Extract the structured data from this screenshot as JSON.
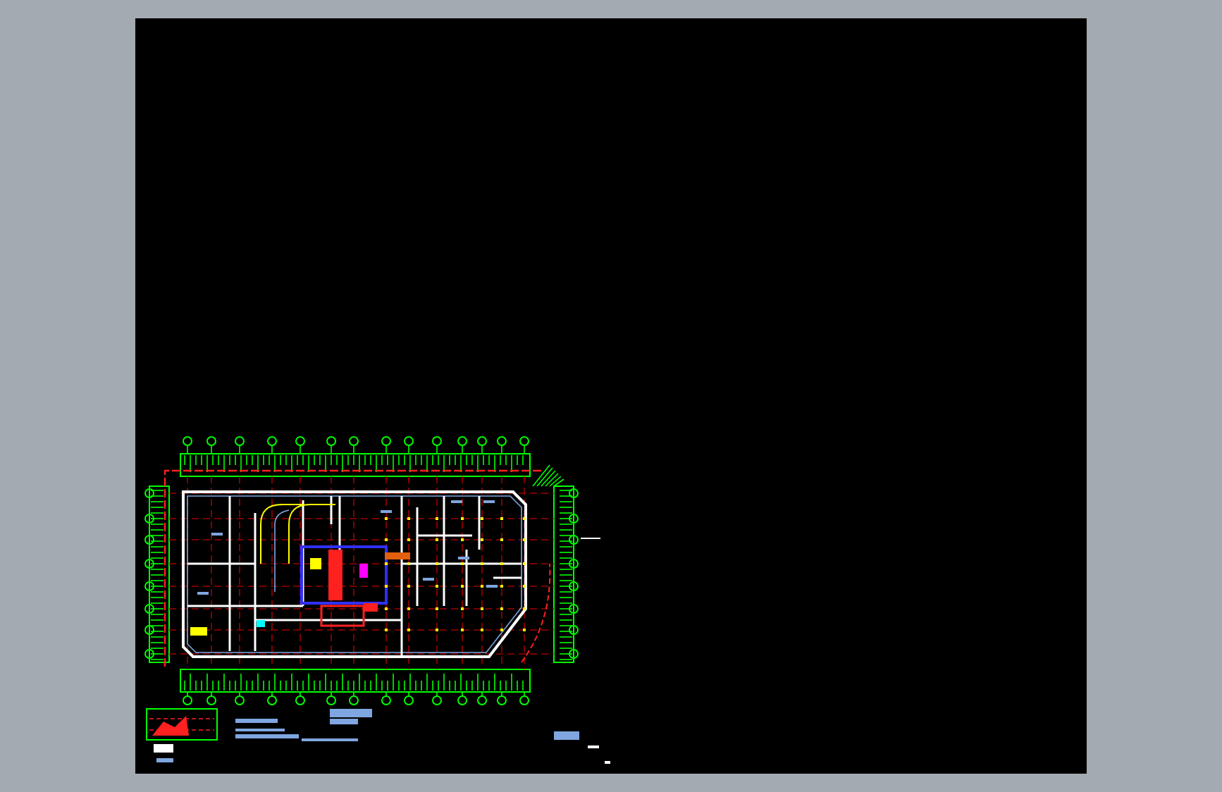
{
  "canvas": {
    "kind": "cad-drawing"
  }
}
